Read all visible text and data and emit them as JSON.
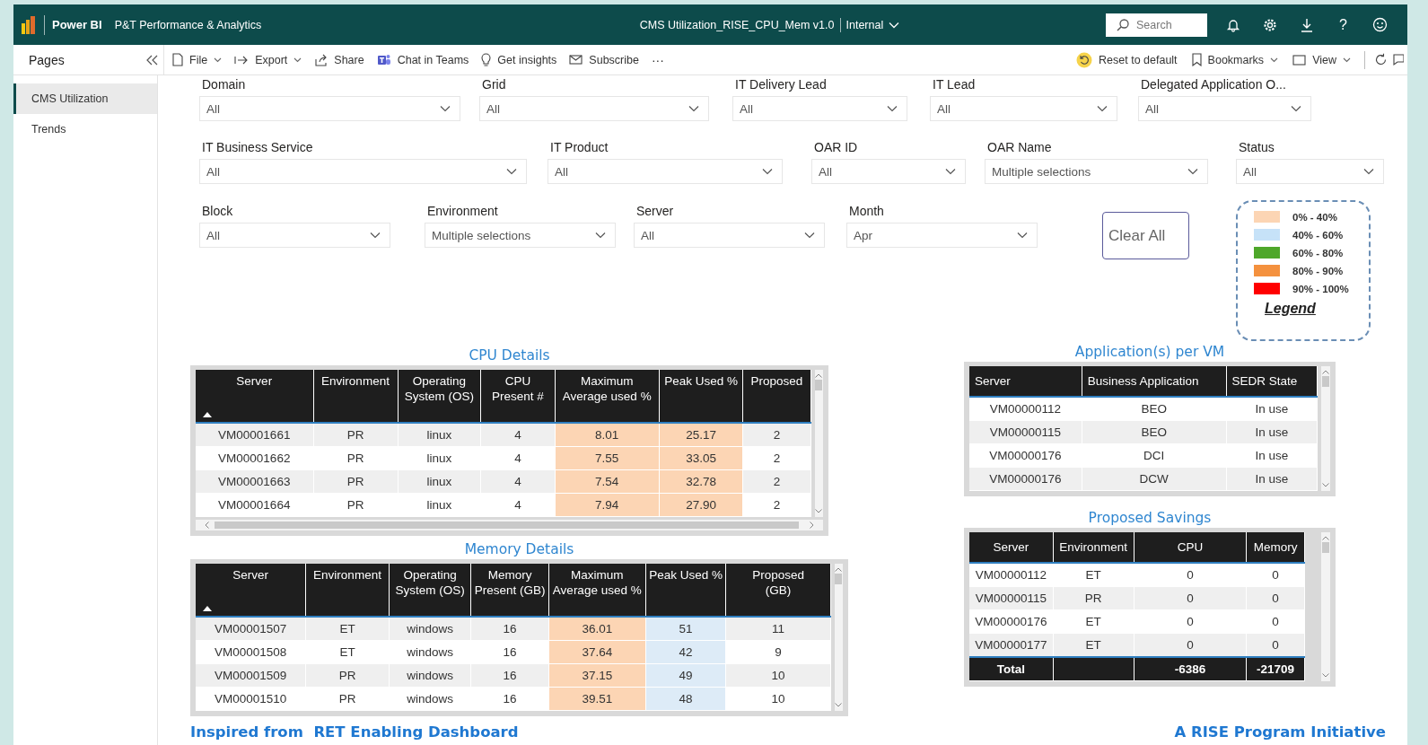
{
  "app": {
    "name": "Power BI",
    "workspace": "P&T Performance & Analytics",
    "report_title": "CMS Utilization_RISE_CPU_Mem v1.0",
    "sensitivity": "Internal",
    "search": {
      "placeholder": "Search"
    },
    "help_text": "?"
  },
  "toolbar": {
    "left": [
      {
        "kind": "file",
        "label": "File",
        "dropdown": true
      },
      {
        "kind": "export",
        "label": "Export",
        "dropdown": true
      },
      {
        "kind": "share",
        "label": "Share",
        "dropdown": false
      },
      {
        "kind": "teams",
        "label": "Chat in Teams",
        "dropdown": false
      },
      {
        "kind": "insights",
        "label": "Get insights",
        "dropdown": false
      },
      {
        "kind": "subscribe",
        "label": "Subscribe",
        "dropdown": false
      },
      {
        "kind": "more",
        "label": "···",
        "dropdown": false
      }
    ],
    "right": [
      {
        "kind": "reset",
        "label": "Reset to default",
        "dropdown": false
      },
      {
        "kind": "bookmark",
        "label": "Bookmarks",
        "dropdown": true
      },
      {
        "kind": "view",
        "label": "View",
        "dropdown": true
      }
    ]
  },
  "pages": {
    "title": "Pages",
    "items": [
      {
        "label": "CMS Utilization",
        "selected": true
      },
      {
        "label": "Trends",
        "selected": false
      }
    ]
  },
  "filters": [
    [
      {
        "label": "Domain",
        "value": "All"
      },
      {
        "label": "Grid",
        "value": "All"
      },
      {
        "label": "IT Delivery Lead",
        "value": "All"
      },
      {
        "label": "IT Lead",
        "value": "All"
      },
      {
        "label": "Delegated Application O...",
        "value": "All"
      }
    ],
    [
      {
        "label": "IT Business Service",
        "value": "All"
      },
      {
        "label": "IT Product",
        "value": "All"
      },
      {
        "label": "OAR ID",
        "value": "All"
      },
      {
        "label": "OAR Name",
        "value": "Multiple selections"
      },
      {
        "label": "Status",
        "value": "All"
      }
    ],
    [
      {
        "label": "Block",
        "value": "All"
      },
      {
        "label": "Environment",
        "value": "Multiple selections"
      },
      {
        "label": "Server",
        "value": "All"
      },
      {
        "label": "Month",
        "value": "Apr"
      }
    ]
  ],
  "clear_button": "Clear All",
  "legend": {
    "title": "Legend",
    "items": [
      {
        "label": "0% - 40%",
        "color": "#fcd5b4"
      },
      {
        "label": "40% - 60%",
        "color": "#c6e2f8"
      },
      {
        "label": "60% - 80%",
        "color": "#4ea72a"
      },
      {
        "label": "80% - 90%",
        "color": "#f4913e"
      },
      {
        "label": "90% - 100%",
        "color": "#ff0000"
      }
    ]
  },
  "cpu_details": {
    "title": "CPU Details",
    "columns": [
      {
        "label": "Server",
        "sorted": true
      },
      {
        "label": "Environment",
        "sorted": false
      },
      {
        "label": "Operating System (OS)",
        "sorted": false
      },
      {
        "label": "CPU Present #",
        "sorted": false
      },
      {
        "label": "Maximum Average used %",
        "sorted": false
      },
      {
        "label": "Peak Used %",
        "sorted": false
      },
      {
        "label": "Proposed",
        "sorted": false
      }
    ],
    "rows": [
      {
        "cells": [
          {
            "text": "VM00001661"
          },
          {
            "text": "PR"
          },
          {
            "text": "linux"
          },
          {
            "text": "4"
          },
          {
            "text": "8.01",
            "color": "#fcd5b4"
          },
          {
            "text": "25.17",
            "color": "#fcd5b4"
          },
          {
            "text": "2"
          }
        ]
      },
      {
        "cells": [
          {
            "text": "VM00001662"
          },
          {
            "text": "PR"
          },
          {
            "text": "linux"
          },
          {
            "text": "4"
          },
          {
            "text": "7.55",
            "color": "#fcd5b4"
          },
          {
            "text": "33.05",
            "color": "#fcd5b4"
          },
          {
            "text": "2"
          }
        ]
      },
      {
        "cells": [
          {
            "text": "VM00001663"
          },
          {
            "text": "PR"
          },
          {
            "text": "linux"
          },
          {
            "text": "4"
          },
          {
            "text": "7.54",
            "color": "#fcd5b4"
          },
          {
            "text": "32.78",
            "color": "#fcd5b4"
          },
          {
            "text": "2"
          }
        ]
      },
      {
        "cells": [
          {
            "text": "VM00001664"
          },
          {
            "text": "PR"
          },
          {
            "text": "linux"
          },
          {
            "text": "4"
          },
          {
            "text": "7.94",
            "color": "#fcd5b4"
          },
          {
            "text": "27.90",
            "color": "#fcd5b4"
          },
          {
            "text": "2"
          }
        ]
      }
    ]
  },
  "memory_details": {
    "title": "Memory Details",
    "columns": [
      {
        "label": "Server",
        "sorted": true
      },
      {
        "label": "Environment",
        "sorted": false
      },
      {
        "label": "Operating System (OS)",
        "sorted": false
      },
      {
        "label": "Memory Present (GB)",
        "sorted": false
      },
      {
        "label": "Maximum Average used %",
        "sorted": false
      },
      {
        "label": "Peak Used %",
        "sorted": false
      },
      {
        "label": "Proposed (GB)",
        "sorted": false
      }
    ],
    "rows": [
      {
        "cells": [
          {
            "text": "VM00001507"
          },
          {
            "text": "ET"
          },
          {
            "text": "windows"
          },
          {
            "text": "16"
          },
          {
            "text": "36.01",
            "color": "#fcd5b4"
          },
          {
            "text": "51",
            "color": "#ddebf7"
          },
          {
            "text": "11"
          }
        ]
      },
      {
        "cells": [
          {
            "text": "VM00001508"
          },
          {
            "text": "ET"
          },
          {
            "text": "windows"
          },
          {
            "text": "16"
          },
          {
            "text": "37.64",
            "color": "#fcd5b4"
          },
          {
            "text": "42",
            "color": "#ddebf7"
          },
          {
            "text": "9"
          }
        ]
      },
      {
        "cells": [
          {
            "text": "VM00001509"
          },
          {
            "text": "PR"
          },
          {
            "text": "windows"
          },
          {
            "text": "16"
          },
          {
            "text": "37.15",
            "color": "#fcd5b4"
          },
          {
            "text": "49",
            "color": "#ddebf7"
          },
          {
            "text": "10"
          }
        ]
      },
      {
        "cells": [
          {
            "text": "VM00001510"
          },
          {
            "text": "PR"
          },
          {
            "text": "windows"
          },
          {
            "text": "16"
          },
          {
            "text": "39.51",
            "color": "#fcd5b4"
          },
          {
            "text": "48",
            "color": "#ddebf7"
          },
          {
            "text": "10"
          }
        ]
      }
    ]
  },
  "applications_per_vm": {
    "title": "Application(s) per VM",
    "columns": [
      {
        "label": "Server",
        "sorted": false
      },
      {
        "label": "Business Application",
        "sorted": false
      },
      {
        "label": "SEDR State",
        "sorted": false
      }
    ],
    "rows": [
      {
        "cells": [
          {
            "text": "VM00000112"
          },
          {
            "text": "BEO"
          },
          {
            "text": "In use"
          }
        ]
      },
      {
        "cells": [
          {
            "text": "VM00000115"
          },
          {
            "text": "BEO"
          },
          {
            "text": "In use"
          }
        ]
      },
      {
        "cells": [
          {
            "text": "VM00000176"
          },
          {
            "text": "DCI"
          },
          {
            "text": "In use"
          }
        ]
      },
      {
        "cells": [
          {
            "text": "VM00000176"
          },
          {
            "text": "DCW"
          },
          {
            "text": "In use"
          }
        ]
      }
    ]
  },
  "proposed_savings": {
    "title": "Proposed Savings",
    "columns": [
      {
        "label": "Server",
        "sorted": false
      },
      {
        "label": "Environment",
        "sorted": false
      },
      {
        "label": "CPU",
        "sorted": false
      },
      {
        "label": "Memory",
        "sorted": false
      }
    ],
    "rows": [
      {
        "cells": [
          {
            "text": "VM00000112"
          },
          {
            "text": "ET"
          },
          {
            "text": "0"
          },
          {
            "text": "0"
          }
        ]
      },
      {
        "cells": [
          {
            "text": "VM00000115"
          },
          {
            "text": "PR"
          },
          {
            "text": "0"
          },
          {
            "text": "0"
          }
        ]
      },
      {
        "cells": [
          {
            "text": "VM00000176"
          },
          {
            "text": "ET"
          },
          {
            "text": "0"
          },
          {
            "text": "0"
          }
        ]
      },
      {
        "cells": [
          {
            "text": "VM00000177"
          },
          {
            "text": "ET"
          },
          {
            "text": "0"
          },
          {
            "text": "0"
          }
        ]
      }
    ],
    "total": {
      "label": "Total",
      "cpu": "-6386",
      "memory": "-21709"
    }
  },
  "footer_left": "Inspired from  RET Enabling Dashboard",
  "footer_right": "A RISE Program Initiative"
}
